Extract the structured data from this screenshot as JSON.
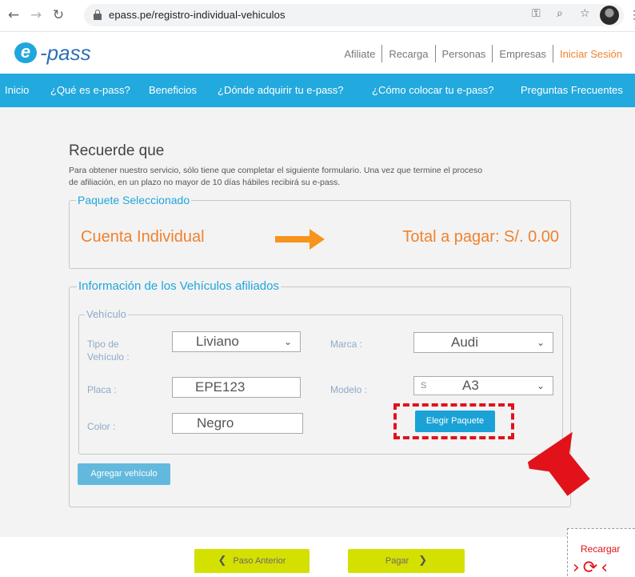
{
  "browser": {
    "url": "epass.pe/registro-individual-vehiculos"
  },
  "header": {
    "logo_text": "-pass",
    "logo_letter": "e",
    "links": [
      "Afiliate",
      "Recarga",
      "Personas",
      "Empresas",
      "Iniciar Sesión"
    ]
  },
  "nav": {
    "items": [
      "Inicio",
      "¿Qué es e-pass?",
      "Beneficios",
      "¿Dónde adquirir tu e-pass?",
      "¿Cómo colocar tu e-pass?",
      "Preguntas Frecuentes"
    ]
  },
  "main": {
    "title": "Recuerde que",
    "intro_line1": "Para obtener nuestro servicio, sólo tiene que completar el siguiente formulario. Una vez que termine el proceso",
    "intro_line2": "de afiliación, en un plazo no mayor de 10 días hábiles recibirá su e-pass.",
    "package": {
      "legend": "Paquete Seleccionado",
      "name": "Cuenta Individual",
      "total": "Total a pagar: S/. 0.00"
    },
    "vehicles": {
      "legend": "Información de los Vehículos afiliados",
      "vehicle_legend": "Vehículo",
      "tipo_label_1": "Tipo de",
      "tipo_label_2": "Vehículo :",
      "tipo_value": "Liviano",
      "marca_label": "Marca :",
      "marca_value": "Audi",
      "placa_label": "Placa :",
      "placa_value": "EPE123",
      "modelo_label": "Modelo :",
      "modelo_prefix": "S",
      "modelo_value": "A3",
      "color_label": "Color :",
      "color_value": "Negro",
      "elegir_button": "Elegir Paquete",
      "agregar_button": "Agregar vehículo"
    }
  },
  "footer": {
    "prev_button": "Paso Anterior",
    "pay_button": "Pagar",
    "recargar_label": "Recargar"
  },
  "colors": {
    "brand_blue": "#22a9de",
    "accent_orange": "#f0822d",
    "annotation_red": "#e2121a",
    "button_yellow": "#d4e000"
  }
}
